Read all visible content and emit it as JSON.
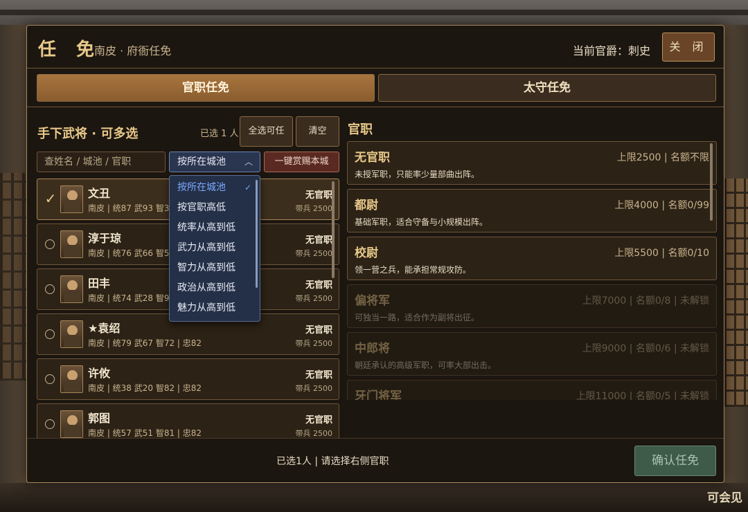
{
  "header": {
    "title": "任 免",
    "subtitle": "南皮 · 府衙任免",
    "rank_text": "当前官爵：刺史",
    "close_label": "关 闭"
  },
  "tabs": [
    {
      "label": "官职任免",
      "active": true
    },
    {
      "label": "太守任免",
      "active": false
    }
  ],
  "generals_panel": {
    "title": "手下武将 · 可多选",
    "selected_count": "已选 1 人",
    "select_all_label": "全选可任",
    "clear_label": "清空",
    "search_placeholder": "查姓名 / 城池 / 官职",
    "sort_selected": "按所在城池",
    "reward_label": "一键赏赐本城"
  },
  "sort_options": [
    "按所在城池",
    "按官职高低",
    "统率从高到低",
    "武力从高到低",
    "智力从高到低",
    "政治从高到低",
    "魅力从高到低"
  ],
  "generals": [
    {
      "name": "文丑",
      "stats": "南皮 | 统87 武93 智30 | 忠88",
      "office": "无官职",
      "troops": "带兵 2500",
      "selected": true
    },
    {
      "name": "淳于琼",
      "stats": "南皮 | 统76 武66 智56 | 忠80",
      "office": "无官职",
      "troops": "带兵 2500",
      "selected": false
    },
    {
      "name": "田丰",
      "stats": "南皮 | 统74 武28 智92 | 忠84",
      "office": "无官职",
      "troops": "带兵 2500",
      "selected": false
    },
    {
      "name": "★袁绍",
      "stats": "南皮 | 统79 武67 智72 | 忠82",
      "office": "无官职",
      "troops": "带兵 2500",
      "selected": false
    },
    {
      "name": "许攸",
      "stats": "南皮 | 统38 武20 智82 | 忠82",
      "office": "无官职",
      "troops": "带兵 2500",
      "selected": false
    },
    {
      "name": "郭图",
      "stats": "南皮 | 统57 武51 智81 | 忠82",
      "office": "无官职",
      "troops": "带兵 2500",
      "selected": false
    }
  ],
  "offices_panel": {
    "title": "官职"
  },
  "offices": [
    {
      "name": "无官职",
      "info": "上限2500 | 名额不限",
      "desc": "未授军职，只能率少量部曲出阵。",
      "locked": false
    },
    {
      "name": "都尉",
      "info": "上限4000 | 名额0/99",
      "desc": "基础军职，适合守备与小规模出阵。",
      "locked": false
    },
    {
      "name": "校尉",
      "info": "上限5500 | 名额0/10",
      "desc": "领一营之兵，能承担常规攻防。",
      "locked": false
    },
    {
      "name": "偏将军",
      "info": "上限7000 | 名额0/8 | 未解锁",
      "desc": "可独当一路，适合作为副将出征。",
      "locked": true
    },
    {
      "name": "中郎将",
      "info": "上限9000 | 名额0/6 | 未解锁",
      "desc": "朝廷承认的高级军职，可率大部出击。",
      "locked": true
    },
    {
      "name": "牙门将军",
      "info": "上限11000 | 名额0/5 | 未解锁",
      "desc": "",
      "locked": true
    }
  ],
  "footer": {
    "status": "已选1人 | 请选择右侧官职",
    "confirm_label": "确认任免"
  },
  "background": {
    "corner_text": "可会见"
  }
}
